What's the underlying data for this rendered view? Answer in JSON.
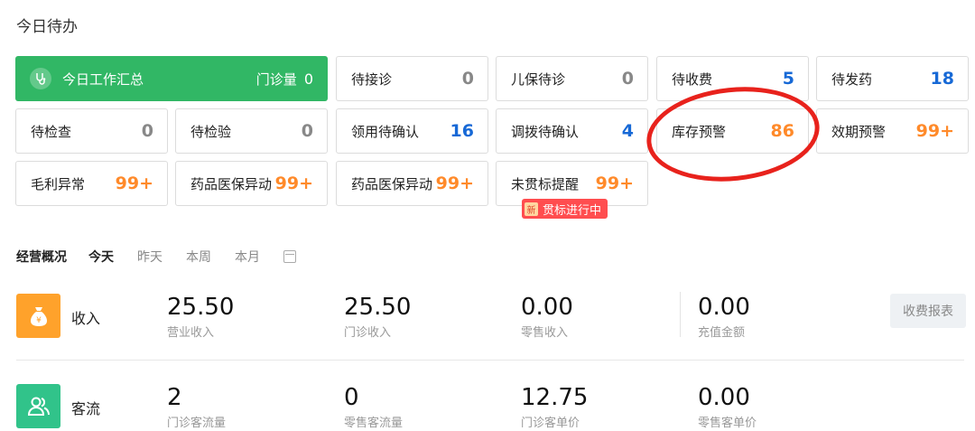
{
  "page": {
    "title": "今日待办"
  },
  "summary": {
    "title": "今日工作汇总",
    "label": "门诊量",
    "value": "0"
  },
  "todo_cards": [
    {
      "label": "待接诊",
      "value": "0",
      "color": "gray"
    },
    {
      "label": "儿保待诊",
      "value": "0",
      "color": "gray"
    },
    {
      "label": "待收费",
      "value": "5",
      "color": "blue"
    },
    {
      "label": "待发药",
      "value": "18",
      "color": "blue"
    },
    {
      "label": "待检查",
      "value": "0",
      "color": "gray"
    },
    {
      "label": "待检验",
      "value": "0",
      "color": "gray"
    },
    {
      "label": "领用待确认",
      "value": "16",
      "color": "blue"
    },
    {
      "label": "调拨待确认",
      "value": "4",
      "color": "blue"
    },
    {
      "label": "库存预警",
      "value": "86",
      "color": "orange"
    },
    {
      "label": "效期预警",
      "value": "99+",
      "color": "orange"
    },
    {
      "label": "毛利异常",
      "value": "99+",
      "color": "orange"
    },
    {
      "label": "药品医保异动",
      "value": "99+",
      "color": "orange"
    },
    {
      "label": "药品医保异动",
      "value": "99+",
      "color": "orange"
    },
    {
      "label": "未贯标提醒",
      "value": "99+",
      "color": "orange"
    }
  ],
  "badge": {
    "new_label": "新",
    "text": "贯标进行中"
  },
  "operations": {
    "title": "经营概况",
    "tabs": [
      "今天",
      "昨天",
      "本周",
      "本月"
    ],
    "active_tab": "今天",
    "income": {
      "label": "收入",
      "icon_glyph": "¥",
      "metrics": [
        {
          "value": "25.50",
          "label": "营业收入"
        },
        {
          "value": "25.50",
          "label": "门诊收入"
        },
        {
          "value": "0.00",
          "label": "零售收入"
        },
        {
          "value": "0.00",
          "label": "充值金额"
        }
      ],
      "report_button": "收费报表"
    },
    "traffic": {
      "label": "客流",
      "metrics": [
        {
          "value": "2",
          "label": "门诊客流量"
        },
        {
          "value": "0",
          "label": "零售客流量"
        },
        {
          "value": "12.75",
          "label": "门诊客单价"
        },
        {
          "value": "0.00",
          "label": "零售客单价"
        }
      ]
    }
  },
  "colors": {
    "green": "#31b765",
    "blue": "#1769d6",
    "orange": "#ff8a2a",
    "income_icon_bg": "#ffa22b",
    "traffic_icon_bg": "#31c38a",
    "annotation_red": "#e8221c"
  }
}
